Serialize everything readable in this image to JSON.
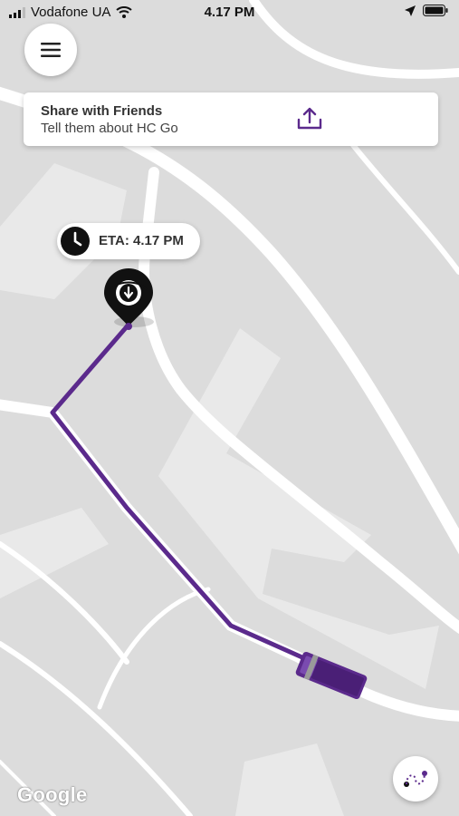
{
  "status_bar": {
    "carrier": "Vodafone UA",
    "time": "4.17 PM",
    "icons": [
      "signal-icon",
      "wifi-icon",
      "location-arrow-icon",
      "battery-icon"
    ]
  },
  "menu": {
    "icon": "hamburger-menu-icon"
  },
  "share_card": {
    "title": "Share with Friends",
    "subtitle": "Tell them about HC Go",
    "icon": "share-upload-icon"
  },
  "eta": {
    "label": "ETA: 4.17 PM",
    "icon": "clock-icon"
  },
  "map": {
    "destination_marker_icon": "pin-download-icon",
    "vehicle_icon": "bus-icon",
    "route_color": "#5b2a8c",
    "attribution": "Google"
  },
  "route_button": {
    "icon": "route-dots-icon"
  },
  "colors": {
    "accent": "#5b2a8c",
    "map_background": "#dcdcdc",
    "roads": "#ffffff",
    "buildings": "#ebebeb"
  }
}
